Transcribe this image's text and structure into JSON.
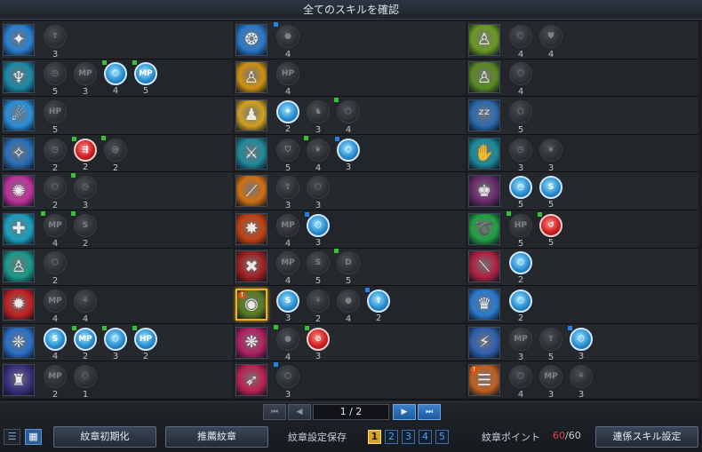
{
  "window": {
    "title": "全てのスキルを確認"
  },
  "columns": [
    [
      {
        "skill": {
          "icon": "lightning-burst-icon",
          "bg": "#2a7fd0",
          "glyph": "✦"
        },
        "runes": [
          {
            "icon": "up-arrow-icon",
            "text": "⇧",
            "level": "3"
          }
        ]
      },
      {
        "skill": {
          "icon": "spirit-figure-icon",
          "bg": "#1a8aa8",
          "glyph": "♆"
        },
        "runes": [
          {
            "icon": "timer-icon",
            "text": "◷",
            "level": "5"
          },
          {
            "icon": "mp-icon",
            "text": "MP",
            "level": "3"
          },
          {
            "icon": "shield-rune-icon",
            "text": "⬡",
            "level": "4",
            "color": "blue",
            "flag": "g"
          },
          {
            "icon": "mp-icon",
            "text": "MP",
            "level": "5",
            "color": "blue",
            "flag": "g"
          }
        ]
      },
      {
        "skill": {
          "icon": "hand-wave-icon",
          "bg": "#2a8fd8",
          "glyph": "☄"
        },
        "runes": [
          {
            "icon": "hp-icon",
            "text": "HP",
            "level": "5"
          }
        ]
      },
      {
        "skill": {
          "icon": "compass-burst-icon",
          "bg": "#2a6fb8",
          "glyph": "✧"
        },
        "runes": [
          {
            "icon": "timer-icon",
            "text": "◷",
            "level": "2"
          },
          {
            "icon": "speed-icon",
            "text": "⇶",
            "level": "2",
            "color": "red",
            "flag": "g"
          },
          {
            "icon": "swirl-icon",
            "text": "@",
            "level": "2",
            "flag": "g"
          }
        ]
      },
      {
        "skill": {
          "icon": "pink-aura-icon",
          "bg": "#c0309a",
          "glyph": "✺"
        },
        "runes": [
          {
            "icon": "shield-rune-icon",
            "text": "⬡",
            "level": "2"
          },
          {
            "icon": "timer-icon",
            "text": "◷",
            "level": "3",
            "flag": "g"
          }
        ]
      },
      {
        "skill": {
          "icon": "heal-cross-icon",
          "bg": "#1aa0c0",
          "glyph": "✚"
        },
        "runes": [
          {
            "icon": "mp-icon",
            "text": "MP",
            "level": "4",
            "flag": "g"
          },
          {
            "icon": "s-rune-icon",
            "text": "S",
            "level": "2",
            "flag": "g"
          }
        ]
      },
      {
        "skill": {
          "icon": "teal-figure-icon",
          "bg": "#1a9a8a",
          "glyph": "♙"
        },
        "runes": [
          {
            "icon": "shield-rune-icon",
            "text": "⬡",
            "level": "2"
          }
        ]
      },
      {
        "skill": {
          "icon": "flame-burst-icon",
          "bg": "#c02020",
          "glyph": "✹"
        },
        "runes": [
          {
            "icon": "mp-icon",
            "text": "MP",
            "level": "4"
          },
          {
            "icon": "claw-icon",
            "text": "⚘",
            "level": "4"
          }
        ]
      },
      {
        "skill": {
          "icon": "wings-emblem-icon",
          "bg": "#2a70c8",
          "glyph": "❈"
        },
        "runes": [
          {
            "icon": "s-rune-icon",
            "text": "S",
            "level": "4",
            "color": "blue"
          },
          {
            "icon": "mp-icon",
            "text": "MP",
            "level": "2",
            "color": "blue",
            "flag": "g"
          },
          {
            "icon": "shield-rune-icon",
            "text": "⬡",
            "level": "3",
            "color": "blue",
            "flag": "g"
          },
          {
            "icon": "hp-icon",
            "text": "HP",
            "level": "2",
            "color": "blue",
            "flag": "g"
          }
        ]
      },
      {
        "skill": {
          "icon": "shadow-duo-icon",
          "bg": "#3a3080",
          "glyph": "♜"
        },
        "runes": [
          {
            "icon": "mp-icon",
            "text": "MP",
            "level": "2"
          },
          {
            "icon": "shield-rune-icon",
            "text": "⬡",
            "level": "1"
          }
        ]
      }
    ],
    [
      {
        "skill": {
          "icon": "vortex-icon",
          "bg": "#2a78c8",
          "glyph": "❂"
        },
        "runes": [
          {
            "icon": "orb-icon",
            "text": "●",
            "level": "4",
            "flag": "b"
          }
        ]
      },
      {
        "skill": {
          "icon": "golden-figure-icon",
          "bg": "#d09010",
          "glyph": "♙"
        },
        "runes": [
          {
            "icon": "hp-icon",
            "text": "HP",
            "level": "4"
          }
        ]
      },
      {
        "skill": {
          "icon": "golden-trio-icon",
          "bg": "#d0a020",
          "glyph": "♟"
        },
        "runes": [
          {
            "icon": "target-icon",
            "text": "⌖",
            "level": "2",
            "color": "blue"
          },
          {
            "icon": "boot-icon",
            "text": "♞",
            "level": "3"
          },
          {
            "icon": "shield-rune-icon",
            "text": "⬡",
            "level": "4",
            "flag": "g"
          }
        ]
      },
      {
        "skill": {
          "icon": "runner-icon",
          "bg": "#208a9a",
          "glyph": "⚔"
        },
        "runes": [
          {
            "icon": "guard-icon",
            "text": "⛉",
            "level": "5"
          },
          {
            "icon": "wings-icon",
            "text": "❦",
            "level": "4",
            "flag": "g"
          },
          {
            "icon": "shield-rune-icon",
            "text": "⬡",
            "level": "3",
            "color": "blue",
            "flag": "b"
          }
        ]
      },
      {
        "skill": {
          "icon": "orange-slash-icon",
          "bg": "#d07010",
          "glyph": "⟋"
        },
        "runes": [
          {
            "icon": "up-arrow-icon",
            "text": "⇧",
            "level": "3"
          },
          {
            "icon": "shield-rune-icon",
            "text": "⬡",
            "level": "3"
          }
        ]
      },
      {
        "skill": {
          "icon": "explosion-icon",
          "bg": "#c04010",
          "glyph": "✸"
        },
        "runes": [
          {
            "icon": "mp-icon",
            "text": "MP",
            "level": "4"
          },
          {
            "icon": "shield-rune-icon",
            "text": "⬡",
            "level": "3",
            "color": "blue",
            "flag": "b"
          }
        ]
      },
      {
        "skill": {
          "icon": "red-strike-icon",
          "bg": "#a02020",
          "glyph": "✖"
        },
        "runes": [
          {
            "icon": "mp-icon",
            "text": "MP",
            "level": "4"
          },
          {
            "icon": "s-rune-icon",
            "text": "S",
            "level": "5"
          },
          {
            "icon": "d-rune-icon",
            "text": "D",
            "level": "5",
            "flag": "g"
          }
        ]
      },
      {
        "skill": {
          "icon": "eye-sigil-icon",
          "bg": "#5a7a20",
          "glyph": "◉",
          "selected": true,
          "warn": true
        },
        "runes": [
          {
            "icon": "s-rune-icon",
            "text": "S",
            "level": "3",
            "color": "blue"
          },
          {
            "icon": "claw-icon",
            "text": "⚘",
            "level": "2"
          },
          {
            "icon": "orb-icon",
            "text": "●",
            "level": "4"
          },
          {
            "icon": "hp-up-icon",
            "text": "⇪",
            "level": "2",
            "color": "blue",
            "flag": "b"
          }
        ]
      },
      {
        "skill": {
          "icon": "pink-sparks-icon",
          "bg": "#b02060",
          "glyph": "❋"
        },
        "runes": [
          {
            "icon": "orb-icon",
            "text": "●",
            "level": "4",
            "flag": "g"
          },
          {
            "icon": "slash-rune-icon",
            "text": "⊘",
            "level": "3",
            "color": "red",
            "flag": "g"
          }
        ]
      },
      {
        "skill": {
          "icon": "pink-dash-icon",
          "bg": "#c02050",
          "glyph": "➶"
        },
        "runes": [
          {
            "icon": "shield-rune-icon",
            "text": "⬡",
            "level": "3",
            "flag": "b"
          }
        ]
      }
    ],
    [
      {
        "skill": {
          "icon": "green-figure-icon",
          "bg": "#6a9a20",
          "glyph": "♙"
        },
        "runes": [
          {
            "icon": "shield-rune-icon",
            "text": "⬡",
            "level": "4"
          },
          {
            "icon": "armor-icon",
            "text": "⛊",
            "level": "4"
          }
        ]
      },
      {
        "skill": {
          "icon": "green-figure-icon",
          "bg": "#5a8a20",
          "glyph": "♙"
        },
        "runes": [
          {
            "icon": "shield-rune-icon",
            "text": "⬡",
            "level": "4"
          }
        ]
      },
      {
        "skill": {
          "icon": "sleep-figure-icon",
          "bg": "#2a6ab0",
          "glyph": "ᶻᶻ"
        },
        "runes": [
          {
            "icon": "shield-rune-icon",
            "text": "⬡",
            "level": "5"
          }
        ]
      },
      {
        "skill": {
          "icon": "reach-hand-icon",
          "bg": "#1a8a9a",
          "glyph": "✋"
        },
        "runes": [
          {
            "icon": "timer-icon",
            "text": "◷",
            "level": "3"
          },
          {
            "icon": "wings-icon",
            "text": "❦",
            "level": "3"
          }
        ]
      },
      {
        "skill": {
          "icon": "dark-warrior-icon",
          "bg": "#6a2a6a",
          "glyph": "♚"
        },
        "runes": [
          {
            "icon": "timer-icon",
            "text": "◷",
            "level": "5",
            "color": "blue"
          },
          {
            "icon": "s-rune-icon",
            "text": "S",
            "level": "5",
            "color": "blue"
          }
        ]
      },
      {
        "skill": {
          "icon": "green-swirl-icon",
          "bg": "#20a040",
          "glyph": "➰"
        },
        "runes": [
          {
            "icon": "hp-icon",
            "text": "HP",
            "level": "5",
            "flag": "g"
          },
          {
            "icon": "clock-back-icon",
            "text": "↺",
            "level": "5",
            "color": "red",
            "flag": "g"
          }
        ]
      },
      {
        "skill": {
          "icon": "crimson-slash-icon",
          "bg": "#b02040",
          "glyph": "⟍"
        },
        "runes": [
          {
            "icon": "shield-rune-icon",
            "text": "⬡",
            "level": "2",
            "color": "blue"
          }
        ]
      },
      {
        "skill": {
          "icon": "angel-wings-icon",
          "bg": "#2a7ad0",
          "glyph": "♛"
        },
        "runes": [
          {
            "icon": "shield-rune-icon",
            "text": "⬡",
            "level": "2",
            "color": "blue"
          }
        ]
      },
      {
        "skill": {
          "icon": "charge-strike-icon",
          "bg": "#3060b0",
          "glyph": "⚡"
        },
        "runes": [
          {
            "icon": "mp-icon",
            "text": "MP",
            "level": "3"
          },
          {
            "icon": "up-arrow-icon",
            "text": "⇧",
            "level": "5"
          },
          {
            "icon": "shield-rune-icon",
            "text": "⬡",
            "level": "3",
            "color": "blue",
            "flag": "b"
          }
        ]
      },
      {
        "skill": {
          "icon": "orange-claw-icon",
          "bg": "#c06020",
          "glyph": "☰",
          "warn": true
        },
        "runes": [
          {
            "icon": "shield-rune-icon",
            "text": "⬡",
            "level": "4"
          },
          {
            "icon": "mp-icon",
            "text": "MP",
            "level": "3"
          },
          {
            "icon": "claw-icon",
            "text": "⚘",
            "level": "3"
          }
        ]
      }
    ]
  ],
  "pager": {
    "first": "⏮",
    "prev": "◀",
    "page": "1 / 2",
    "next": "▶",
    "last": "⏭"
  },
  "toolbar": {
    "list_view_icon": "☰",
    "grid_view_icon": "▦",
    "reset_label": "紋章初期化",
    "recommend_label": "推薦紋章",
    "save_label": "紋章設定保存",
    "slots": [
      "1",
      "2",
      "3",
      "4",
      "5"
    ],
    "points_label": "紋章ポイント",
    "points_current": "60",
    "points_max": "/60",
    "chain_label": "連係スキル設定"
  },
  "colors": {
    "accent": "#2a8fd0",
    "selected_border": "#f0b020",
    "points_current": "#e04040"
  }
}
